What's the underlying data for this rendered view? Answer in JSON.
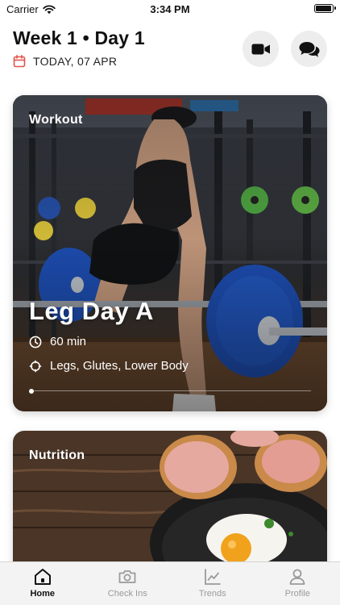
{
  "status_bar": {
    "carrier": "Carrier",
    "time": "3:34 PM",
    "battery_level": 0.9
  },
  "header": {
    "title": "Week 1 • Day 1",
    "date": "TODAY, 07 APR",
    "icons": {
      "date": "calendar-icon",
      "video_button": "video-camera-icon",
      "chat_button": "chat-bubbles-icon"
    },
    "accent_color": "#e2534b"
  },
  "workout_card": {
    "label": "Workout",
    "title": "Leg Day A",
    "duration": "60 min",
    "focus": "Legs, Glutes, Lower Body",
    "icons": {
      "duration": "clock-icon",
      "focus": "target-icon"
    },
    "carousel_position": 0
  },
  "nutrition_card": {
    "label": "Nutrition"
  },
  "tab_bar": {
    "active_tab": "Home",
    "tabs": [
      {
        "label": "Home",
        "icon": "home-icon"
      },
      {
        "label": "Check Ins",
        "icon": "camera-icon"
      },
      {
        "label": "Trends",
        "icon": "trend-chart-icon"
      },
      {
        "label": "Profile",
        "icon": "person-icon"
      }
    ]
  }
}
